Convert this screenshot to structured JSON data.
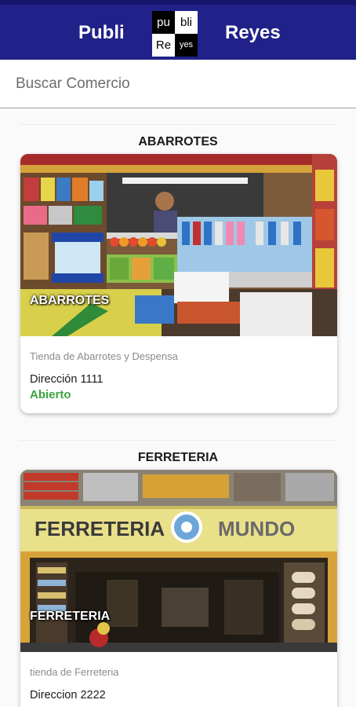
{
  "appbar": {
    "title_left": "Publi",
    "title_right": "Reyes",
    "logo": {
      "tl": "pu",
      "tr": "bli",
      "bl": "Re",
      "br": "yes"
    }
  },
  "search": {
    "placeholder": "Buscar Comercio",
    "value": ""
  },
  "sections": [
    {
      "title": "ABARROTES",
      "card": {
        "photo_label": "ABARROTES",
        "description": "Tienda de Abarrotes y Despensa",
        "address": "Dirección 1111",
        "status": "Abierto"
      }
    },
    {
      "title": "FERRETERIA",
      "card": {
        "photo_label": "FERRETERIA",
        "sign_left": "FERRETERIA",
        "sign_right": "MUNDO",
        "description": "tienda de Ferreteria",
        "address": "Direccion 2222",
        "status": ""
      }
    }
  ],
  "colors": {
    "appbar": "#21218a",
    "open_status": "#3aa33e"
  }
}
